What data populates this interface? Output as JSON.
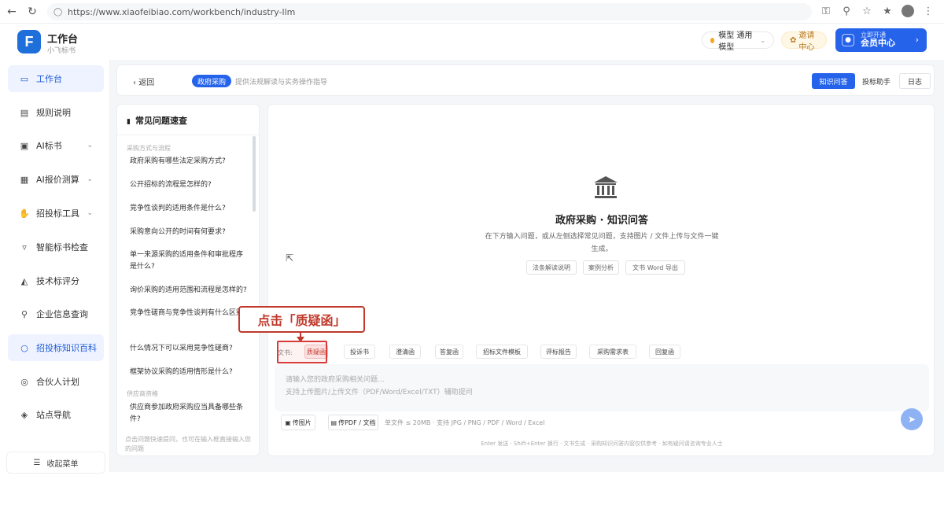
{
  "browser": {
    "url": "https://www.xiaofeibiao.com/workbench/industry-llm"
  },
  "header": {
    "app_title": "工作台",
    "app_subtitle": "小飞标书",
    "logo_letter": "F",
    "model_pill": "模型 通用模型",
    "gift_pill": "邀请中心",
    "member_small": "立即开通",
    "member_main": "会员中心"
  },
  "sidebar": {
    "items": [
      {
        "label": "工作台",
        "icon": "monitor-icon",
        "active": true
      },
      {
        "label": "规则说明",
        "icon": "document-icon"
      },
      {
        "label": "AI标书",
        "icon": "ai-book-icon",
        "chevron": true
      },
      {
        "label": "AI报价测算",
        "icon": "calculator-icon",
        "chevron": true
      },
      {
        "label": "招投标工具",
        "icon": "hand-icon",
        "chevron": true
      },
      {
        "label": "智能标书检查",
        "icon": "filter-icon"
      },
      {
        "label": "技术标评分",
        "icon": "score-icon"
      },
      {
        "label": "企业信息查询",
        "icon": "search-icon"
      },
      {
        "label": "招投标知识百科",
        "icon": "chat-icon",
        "highlighted": true
      },
      {
        "label": "合伙人计划",
        "icon": "partner-icon"
      },
      {
        "label": "站点导航",
        "icon": "navigation-icon"
      }
    ],
    "collapse_label": "收起菜单"
  },
  "topbar": {
    "back_label": "返回",
    "tag_label": "政府采购",
    "description": "提供法规解读与实务操作指导",
    "tabs": [
      {
        "label": "知识问答",
        "active": true
      },
      {
        "label": "投标助手"
      },
      {
        "label": "日志"
      }
    ]
  },
  "faq": {
    "title": "常见问题速查",
    "categories": [
      {
        "name": "采购方式与流程",
        "questions": [
          "政府采购有哪些法定采购方式?",
          "公开招标的流程是怎样的?",
          "竞争性谈判的适用条件是什么?",
          "采购意向公开的时间有何要求?",
          "单一来源采购的适用条件和审批程序是什么?",
          "询价采购的适用范围和流程是怎样的?",
          "竞争性磋商与竞争性谈判有什么区别?",
          "什么情况下可以采用竞争性磋商?",
          "框架协议采购的适用情形是什么?"
        ]
      },
      {
        "name": "供应商资格",
        "questions": [
          "供应商参加政府采购应当具备哪些条件?"
        ]
      }
    ],
    "footer": "点击问题快速提问，也可在输入框直接输入您的问题"
  },
  "chat": {
    "title": "政府采购 · 知识问答",
    "description": "在下方输入问题，或从左侧选择常见问题，支持图片 / 文件上传与文件一键生成。",
    "samples": [
      "法条解读说明",
      "案例分析",
      "文书 Word 导出"
    ],
    "doc_type_label": "文书:",
    "doc_chips": [
      {
        "label": "质疑函",
        "selected": true
      },
      {
        "label": "投诉书"
      },
      {
        "label": "澄清函"
      },
      {
        "label": "答复函"
      },
      {
        "label": "招标文件模板"
      },
      {
        "label": "评标报告"
      },
      {
        "label": "采购需求表"
      },
      {
        "label": "回复函"
      }
    ],
    "input_placeholder_1": "请输入您的政府采购相关问题...",
    "input_placeholder_2": "支持上传图片/上传文件（PDF/Word/Excel/TXT）辅助提问",
    "upload_image_label": "传图片",
    "upload_file_label": "传PDF / 文档",
    "upload_hint": "单文件 ≤ 20MB · 支持 JPG / PNG / PDF / Word / Excel",
    "footer": "Enter 发送 · Shift+Enter 换行 · 文书生成 · 采购知识问答内容仅供参考 · 如有疑问请咨询专业人士"
  },
  "annotation": {
    "callout_text": "点击「质疑函」"
  },
  "colors": {
    "primary": "#2563eb",
    "annotation_red": "#c0392b"
  }
}
